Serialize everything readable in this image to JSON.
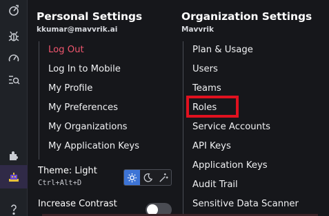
{
  "personal": {
    "title": "Personal Settings",
    "email": "kkumar@mavvrik.ai",
    "items": [
      {
        "label": "Log Out"
      },
      {
        "label": "Log In to Mobile"
      },
      {
        "label": "My Profile"
      },
      {
        "label": "My Preferences"
      },
      {
        "label": "My Organizations"
      },
      {
        "label": "My Application Keys"
      }
    ]
  },
  "organization": {
    "title": "Organization Settings",
    "name": "Mavvrik",
    "items": [
      {
        "label": "Plan & Usage"
      },
      {
        "label": "Users"
      },
      {
        "label": "Teams"
      },
      {
        "label": "Roles"
      },
      {
        "label": "Service Accounts"
      },
      {
        "label": "API Keys"
      },
      {
        "label": "Application Keys"
      },
      {
        "label": "Audit Trail"
      },
      {
        "label": "Sensitive Data Scanner"
      }
    ]
  },
  "theme": {
    "label": "Theme: Light",
    "shortcut": "Ctrl+Alt+D",
    "options": [
      "sun-icon",
      "moon-icon",
      "auto-theme-icon"
    ],
    "selected": "light"
  },
  "contrast": {
    "label": "Increase Contrast",
    "enabled": false
  },
  "rail": {
    "icons": [
      "rocket-icon",
      "bug-icon",
      "speedometer-icon",
      "debug-list-icon",
      "puzzle-icon",
      "avatar-icon",
      "help-icon"
    ]
  },
  "colors": {
    "danger": "#f0566e",
    "accent": "#3d74d6",
    "highlight": "#e0111f"
  }
}
